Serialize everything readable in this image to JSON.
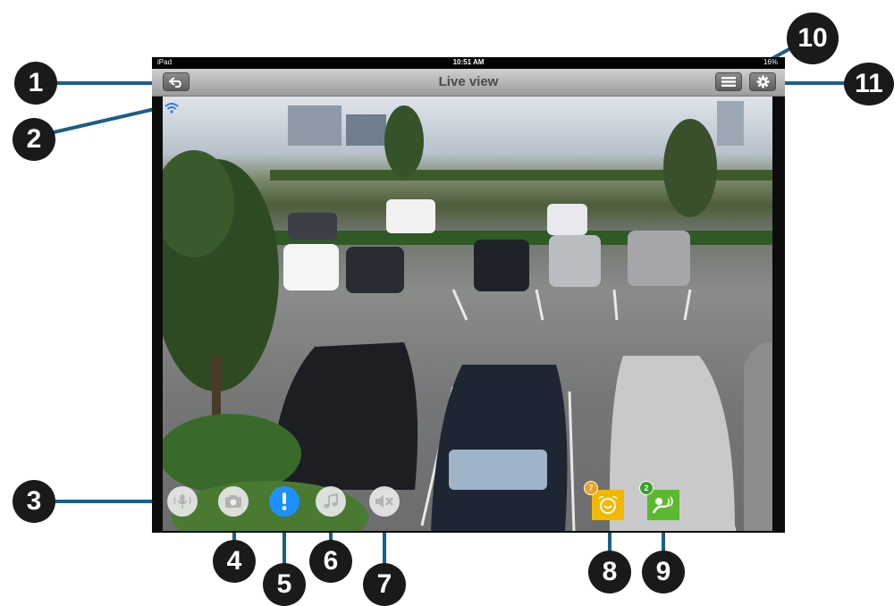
{
  "statusbar": {
    "device": "iPad",
    "time": "10:51 AM",
    "battery": "16%"
  },
  "navbar": {
    "title": "Live view"
  },
  "overlay": {
    "motion_badge_count": "7",
    "sound_badge_count": "2"
  },
  "callouts": {
    "c1": "1",
    "c2": "2",
    "c3": "3",
    "c4": "4",
    "c5": "5",
    "c6": "6",
    "c7": "7",
    "c8": "8",
    "c9": "9",
    "c10": "10",
    "c11": "11"
  },
  "colors": {
    "line": "#1a5f86",
    "accent_blue": "#1e90ff",
    "sound_green": "#5cb82f",
    "motion_yellow": "#f2b800",
    "badge_orange": "#f0a020",
    "badge_green": "#3a9e2a"
  },
  "icons": [
    "back-arrow-icon",
    "wifi-icon",
    "microphone-icon",
    "camera-icon",
    "alert-icon",
    "music-note-icon",
    "mute-icon",
    "motion-detection-icon",
    "sound-detection-icon",
    "list-icon",
    "gear-icon"
  ]
}
